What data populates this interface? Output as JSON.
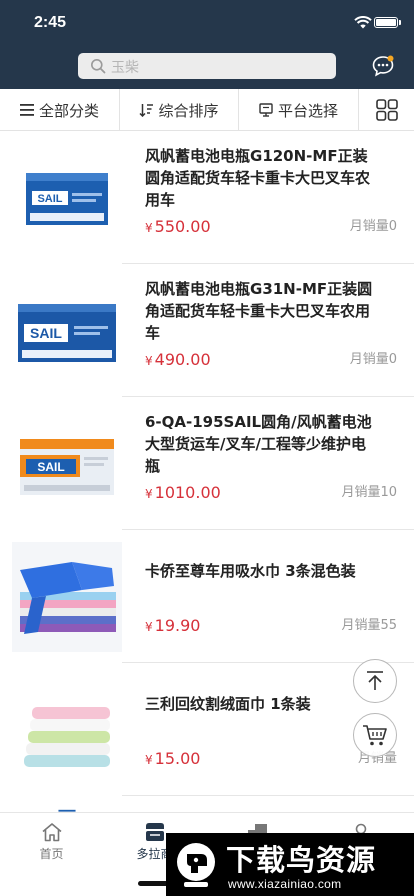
{
  "status_bar": {
    "time": "2:45"
  },
  "search": {
    "placeholder": "玉柴"
  },
  "filter_bar": {
    "all_categories": "全部分类",
    "sort": "综合排序",
    "platform": "平台选择"
  },
  "products": [
    {
      "title": "风帆蓄电池电瓶G120N-MF正装圆角适配货车轻卡重卡大巴叉车农用车",
      "currency": "¥",
      "price": "550.00",
      "sales": "月销量0",
      "image": "battery-blue",
      "brand": "SAIL"
    },
    {
      "title": "风帆蓄电池电瓶G31N-MF正装圆角适配货车轻卡重卡大巴叉车农用车",
      "currency": "¥",
      "price": "490.00",
      "sales": "月销量0",
      "image": "battery-blue",
      "brand": "SAIL"
    },
    {
      "title": "6-QA-195SAIL圆角/风帆蓄电池大型货运车/叉车/工程等少维护电瓶",
      "currency": "¥",
      "price": "1010.00",
      "sales": "月销量10",
      "image": "battery-orange",
      "brand": "SAIL"
    },
    {
      "title": "卡侨至尊车用吸水巾 3条混色装",
      "currency": "¥",
      "price": "19.90",
      "sales": "月销量55",
      "image": "towels-blue"
    },
    {
      "title": "三利回纹割绒面巾 1条装",
      "currency": "¥",
      "price": "15.00",
      "sales": "月销量",
      "image": "towels-pastel"
    }
  ],
  "floating": {
    "top_icon": "arrow-up-icon",
    "cart_icon": "cart-icon"
  },
  "tab_bar": {
    "home": "首页",
    "active": "多拉商"
  },
  "watermark": {
    "title": "下载鸟资源",
    "url": "www.xiazainiao.com"
  },
  "colors": {
    "header": "#25374b",
    "price": "#d6313a",
    "search_bg": "#ececec"
  }
}
